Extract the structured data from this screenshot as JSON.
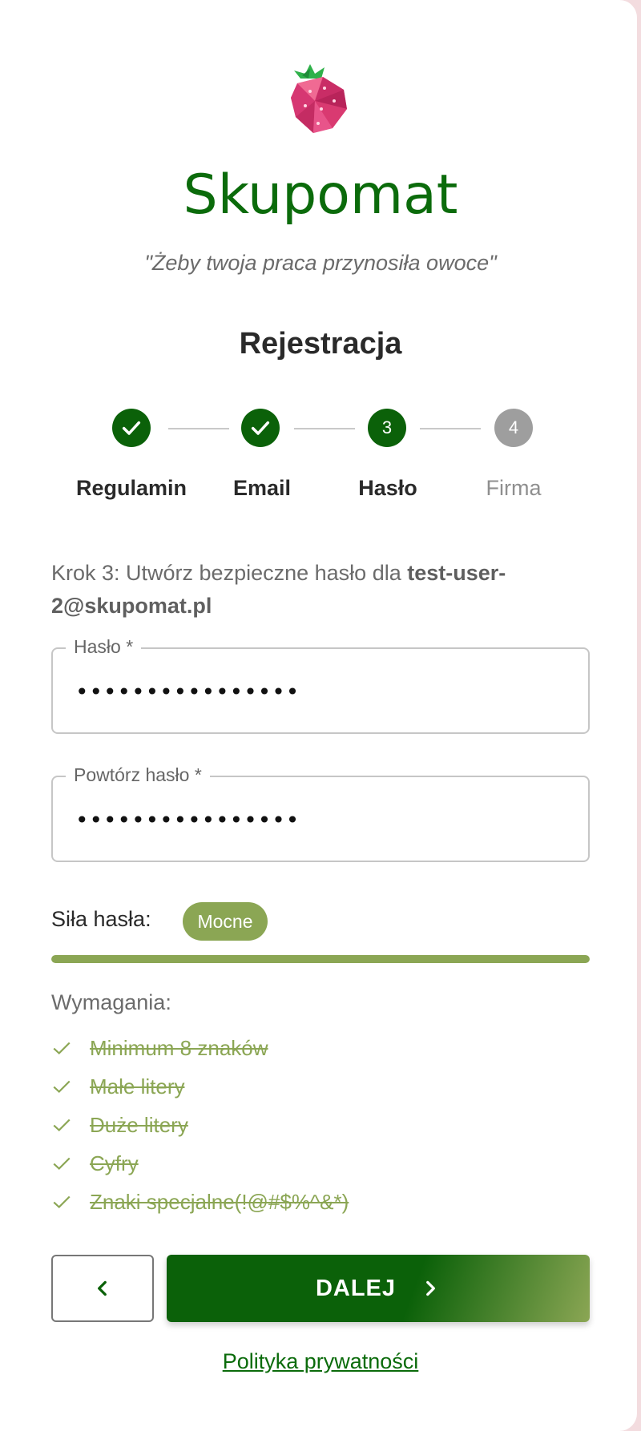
{
  "app": {
    "title": "Skupomat",
    "slogan": "\"Żeby twoja praca przynosiła owoce\""
  },
  "page": {
    "heading": "Rejestracja"
  },
  "stepper": {
    "steps": [
      {
        "label": "Regulamin",
        "number": "1",
        "state": "done"
      },
      {
        "label": "Email",
        "number": "2",
        "state": "done"
      },
      {
        "label": "Hasło",
        "number": "3",
        "state": "active"
      },
      {
        "label": "Firma",
        "number": "4",
        "state": "pending"
      }
    ]
  },
  "intro": {
    "text": "Krok 3: Utwórz bezpieczne hasło dla ",
    "email": "test-user-2@skupomat.pl"
  },
  "form": {
    "password": {
      "label": "Hasło *",
      "value": "••••••••••••••••"
    },
    "confirm": {
      "label": "Powtórz hasło *",
      "value": "••••••••••••••••"
    }
  },
  "strength": {
    "label": "Siła hasła:",
    "badge": "Mocne",
    "level": 1.0,
    "color": "#8ba654"
  },
  "requirements": {
    "title": "Wymagania:",
    "items": [
      {
        "label": "Minimum 8 znaków",
        "met": true
      },
      {
        "label": "Małe litery",
        "met": true
      },
      {
        "label": "Duże litery",
        "met": true
      },
      {
        "label": "Cyfry",
        "met": true
      },
      {
        "label": "Znaki specjalne(!@#$%^&*)",
        "met": true
      }
    ]
  },
  "buttons": {
    "back_icon": "chevron-left-icon",
    "next_label": "DALEJ",
    "next_icon": "chevron-right-icon"
  },
  "footer": {
    "privacy_link": "Polityka prywatności"
  },
  "colors": {
    "primary": "#0b6109",
    "accent": "#8ba654",
    "pending": "#9e9e9e"
  }
}
